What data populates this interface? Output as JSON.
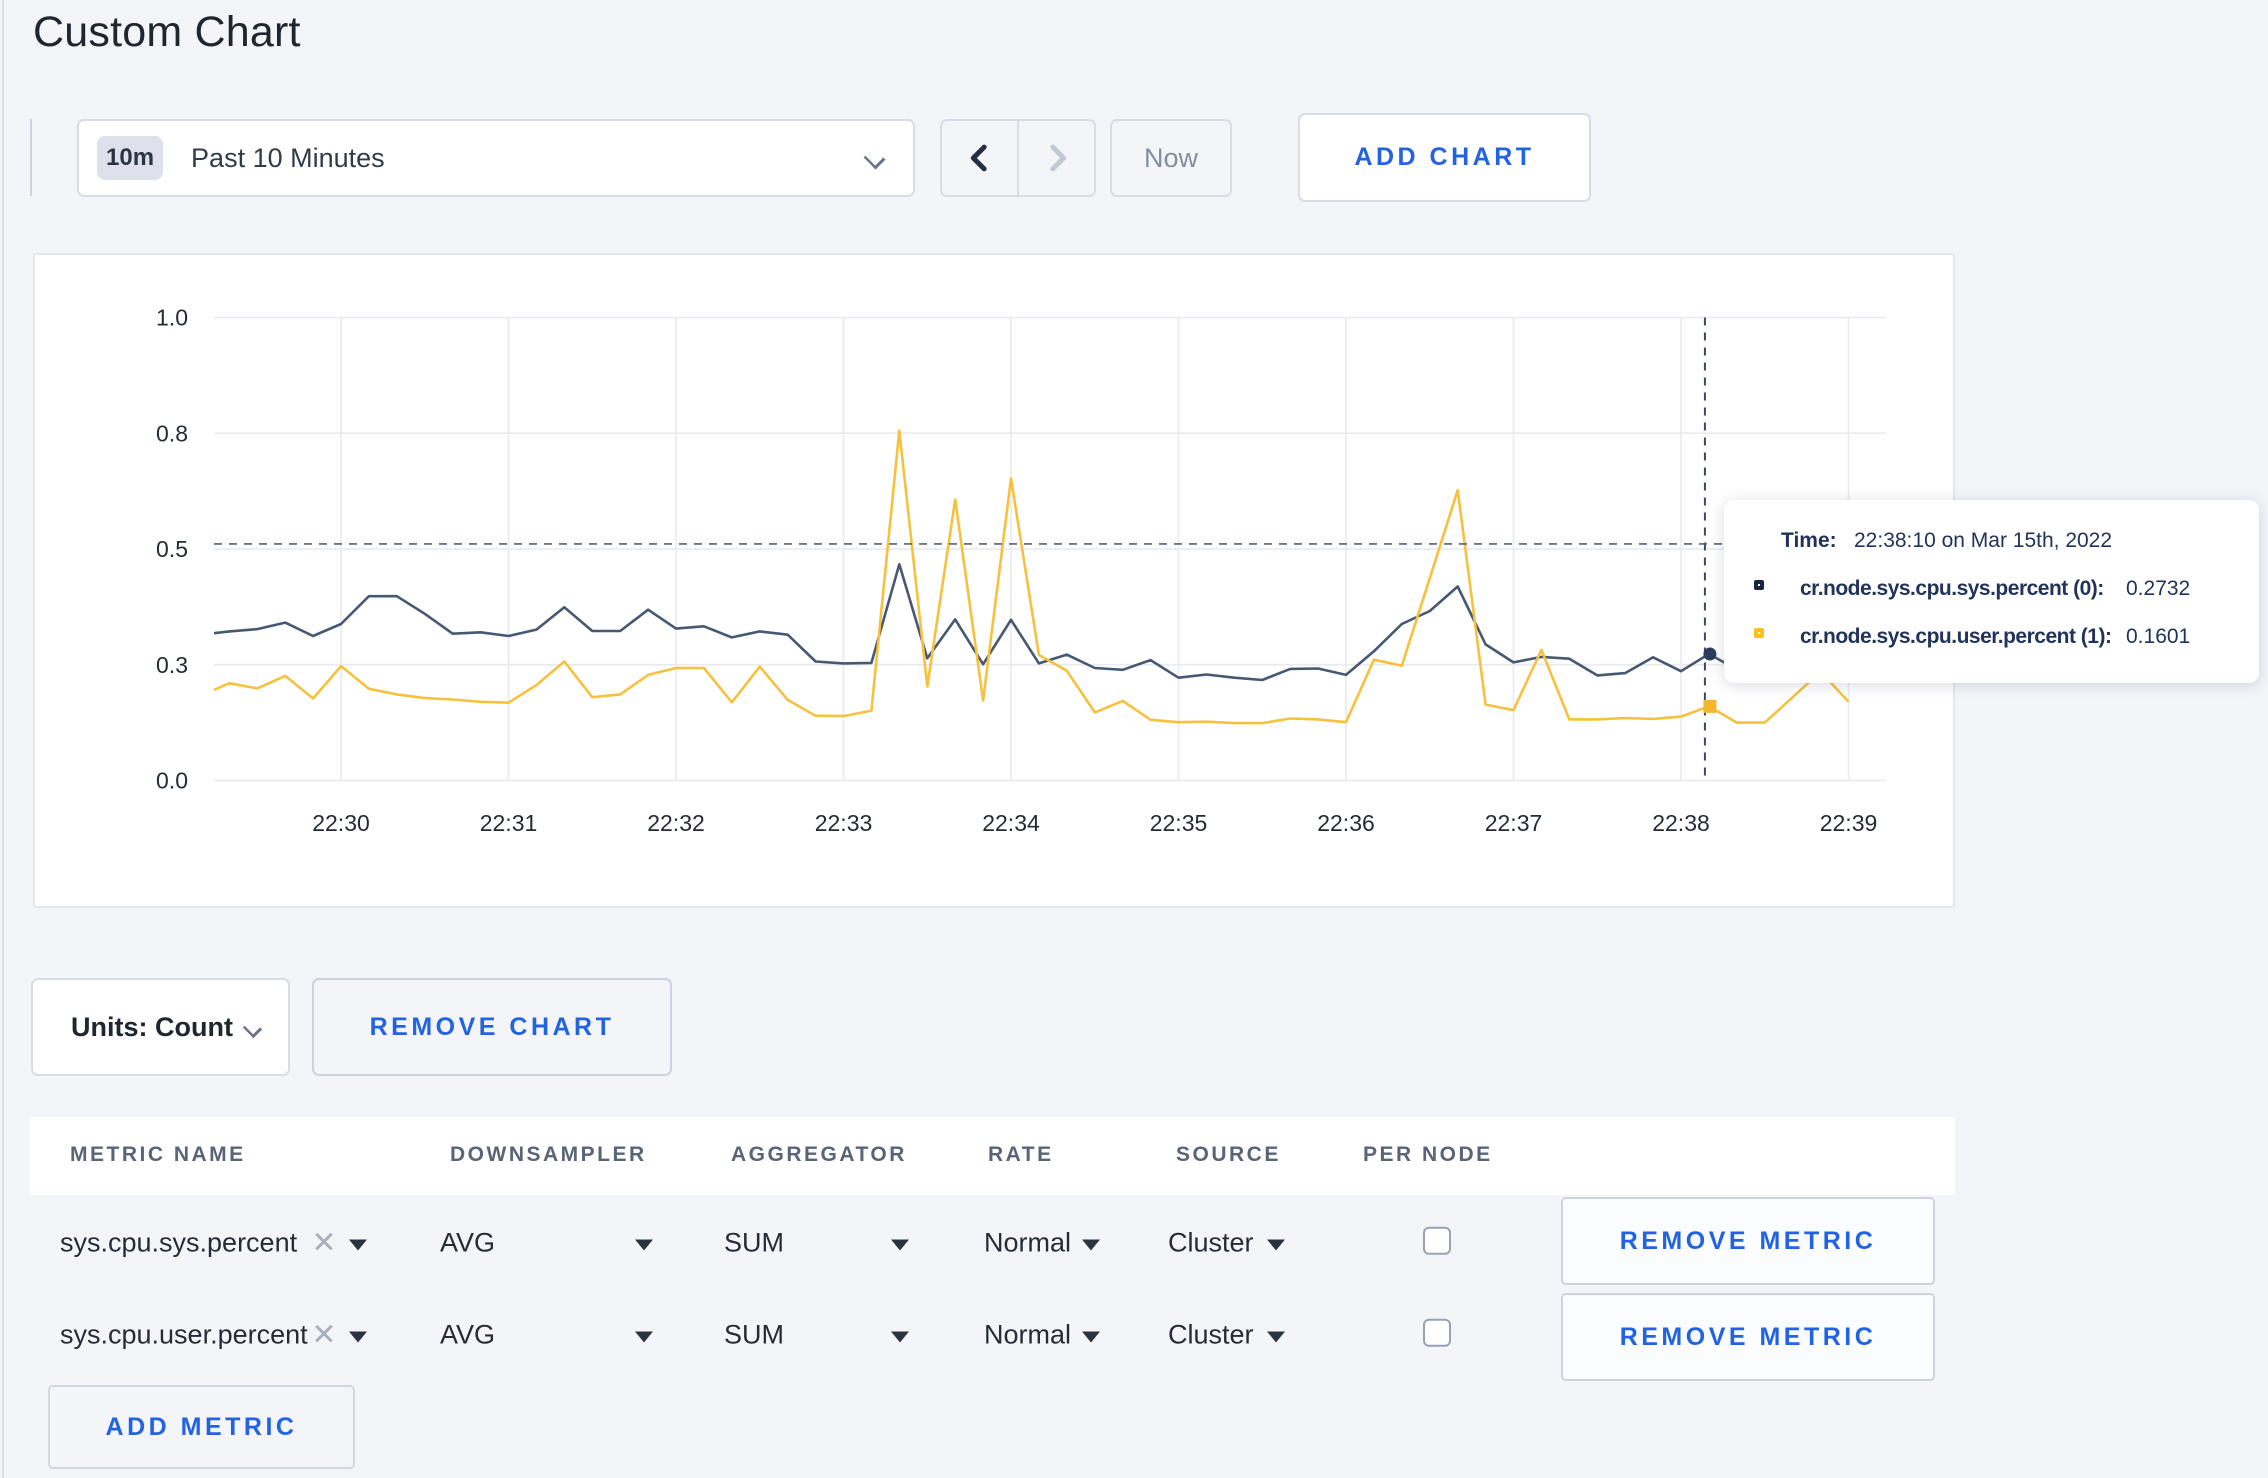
{
  "page": {
    "title": "Custom Chart"
  },
  "toolbar": {
    "time_window_badge": "10m",
    "time_window_label": "Past 10 Minutes",
    "now_label": "Now",
    "add_chart_label": "ADD CHART"
  },
  "chart_data": {
    "type": "line",
    "ylim": [
      0,
      1
    ],
    "grid": true,
    "legend_position": "tooltip",
    "y_ticks": [
      {
        "v": 0.0,
        "label": "0.0"
      },
      {
        "v": 0.25,
        "label": "0.3"
      },
      {
        "v": 0.5,
        "label": "0.5"
      },
      {
        "v": 0.75,
        "label": "0.8"
      },
      {
        "v": 1.0,
        "label": "1.0"
      }
    ],
    "x_ticks": [
      "22:30",
      "22:31",
      "22:32",
      "22:33",
      "22:34",
      "22:35",
      "22:36",
      "22:37",
      "22:38",
      "22:39"
    ],
    "x_domain": [
      "22:29:14",
      "22:39:14"
    ],
    "start_time": "22:29:10",
    "interval_seconds": 10,
    "series": [
      {
        "name": "cr.node.sys.cpu.sys.percent",
        "color": "#475872",
        "marker": "circle",
        "marker_color": "#2d3c59",
        "values": [
          0.315,
          0.322,
          0.327,
          0.341,
          0.312,
          0.338,
          0.398,
          0.398,
          0.36,
          0.317,
          0.32,
          0.312,
          0.326,
          0.374,
          0.323,
          0.323,
          0.369,
          0.328,
          0.333,
          0.309,
          0.322,
          0.315,
          0.257,
          0.253,
          0.254,
          0.467,
          0.264,
          0.348,
          0.251,
          0.347,
          0.253,
          0.272,
          0.243,
          0.239,
          0.26,
          0.222,
          0.229,
          0.222,
          0.217,
          0.241,
          0.242,
          0.228,
          0.279,
          0.338,
          0.366,
          0.419,
          0.294,
          0.255,
          0.267,
          0.263,
          0.227,
          0.232,
          0.266,
          0.236,
          0.2732,
          0.24,
          0.252,
          0.262,
          0.255,
          0.264,
          0.27
        ]
      },
      {
        "name": "cr.node.sys.cpu.user.percent",
        "color": "#f7c13e",
        "marker": "square",
        "marker_color": "#f3b72e",
        "values": [
          0.184,
          0.21,
          0.199,
          0.226,
          0.177,
          0.247,
          0.198,
          0.186,
          0.178,
          0.175,
          0.17,
          0.168,
          0.206,
          0.257,
          0.18,
          0.186,
          0.228,
          0.243,
          0.243,
          0.169,
          0.246,
          0.174,
          0.14,
          0.139,
          0.151,
          0.756,
          0.203,
          0.607,
          0.173,
          0.652,
          0.271,
          0.237,
          0.147,
          0.172,
          0.131,
          0.126,
          0.127,
          0.124,
          0.124,
          0.134,
          0.132,
          0.126,
          0.261,
          0.248,
          0.437,
          0.627,
          0.164,
          0.152,
          0.282,
          0.132,
          0.132,
          0.135,
          0.133,
          0.138,
          0.1601,
          0.125,
          0.125,
          0.18,
          0.235,
          0.17
        ]
      }
    ],
    "crosshair": {
      "time": "22:38:10",
      "y_value": 0.511
    }
  },
  "tooltip": {
    "time_label": "Time:",
    "time_value": "22:38:10 on Mar 15th, 2022",
    "series": [
      {
        "label": "cr.node.sys.cpu.sys.percent (0):",
        "value": "0.2732"
      },
      {
        "label": "cr.node.sys.cpu.user.percent (1):",
        "value": "0.1601"
      }
    ]
  },
  "chart_controls": {
    "units_label": "Units: Count",
    "remove_chart_label": "REMOVE CHART"
  },
  "metrics_table": {
    "columns": [
      "METRIC NAME",
      "DOWNSAMPLER",
      "AGGREGATOR",
      "RATE",
      "SOURCE",
      "PER NODE"
    ],
    "rows": [
      {
        "metric": "sys.cpu.sys.percent",
        "downsampler": "AVG",
        "aggregator": "SUM",
        "rate": "Normal",
        "source": "Cluster",
        "per_node": false,
        "remove_label": "REMOVE METRIC"
      },
      {
        "metric": "sys.cpu.user.percent",
        "downsampler": "AVG",
        "aggregator": "SUM",
        "rate": "Normal",
        "source": "Cluster",
        "per_node": false,
        "remove_label": "REMOVE METRIC"
      }
    ],
    "add_metric_label": "ADD METRIC"
  }
}
